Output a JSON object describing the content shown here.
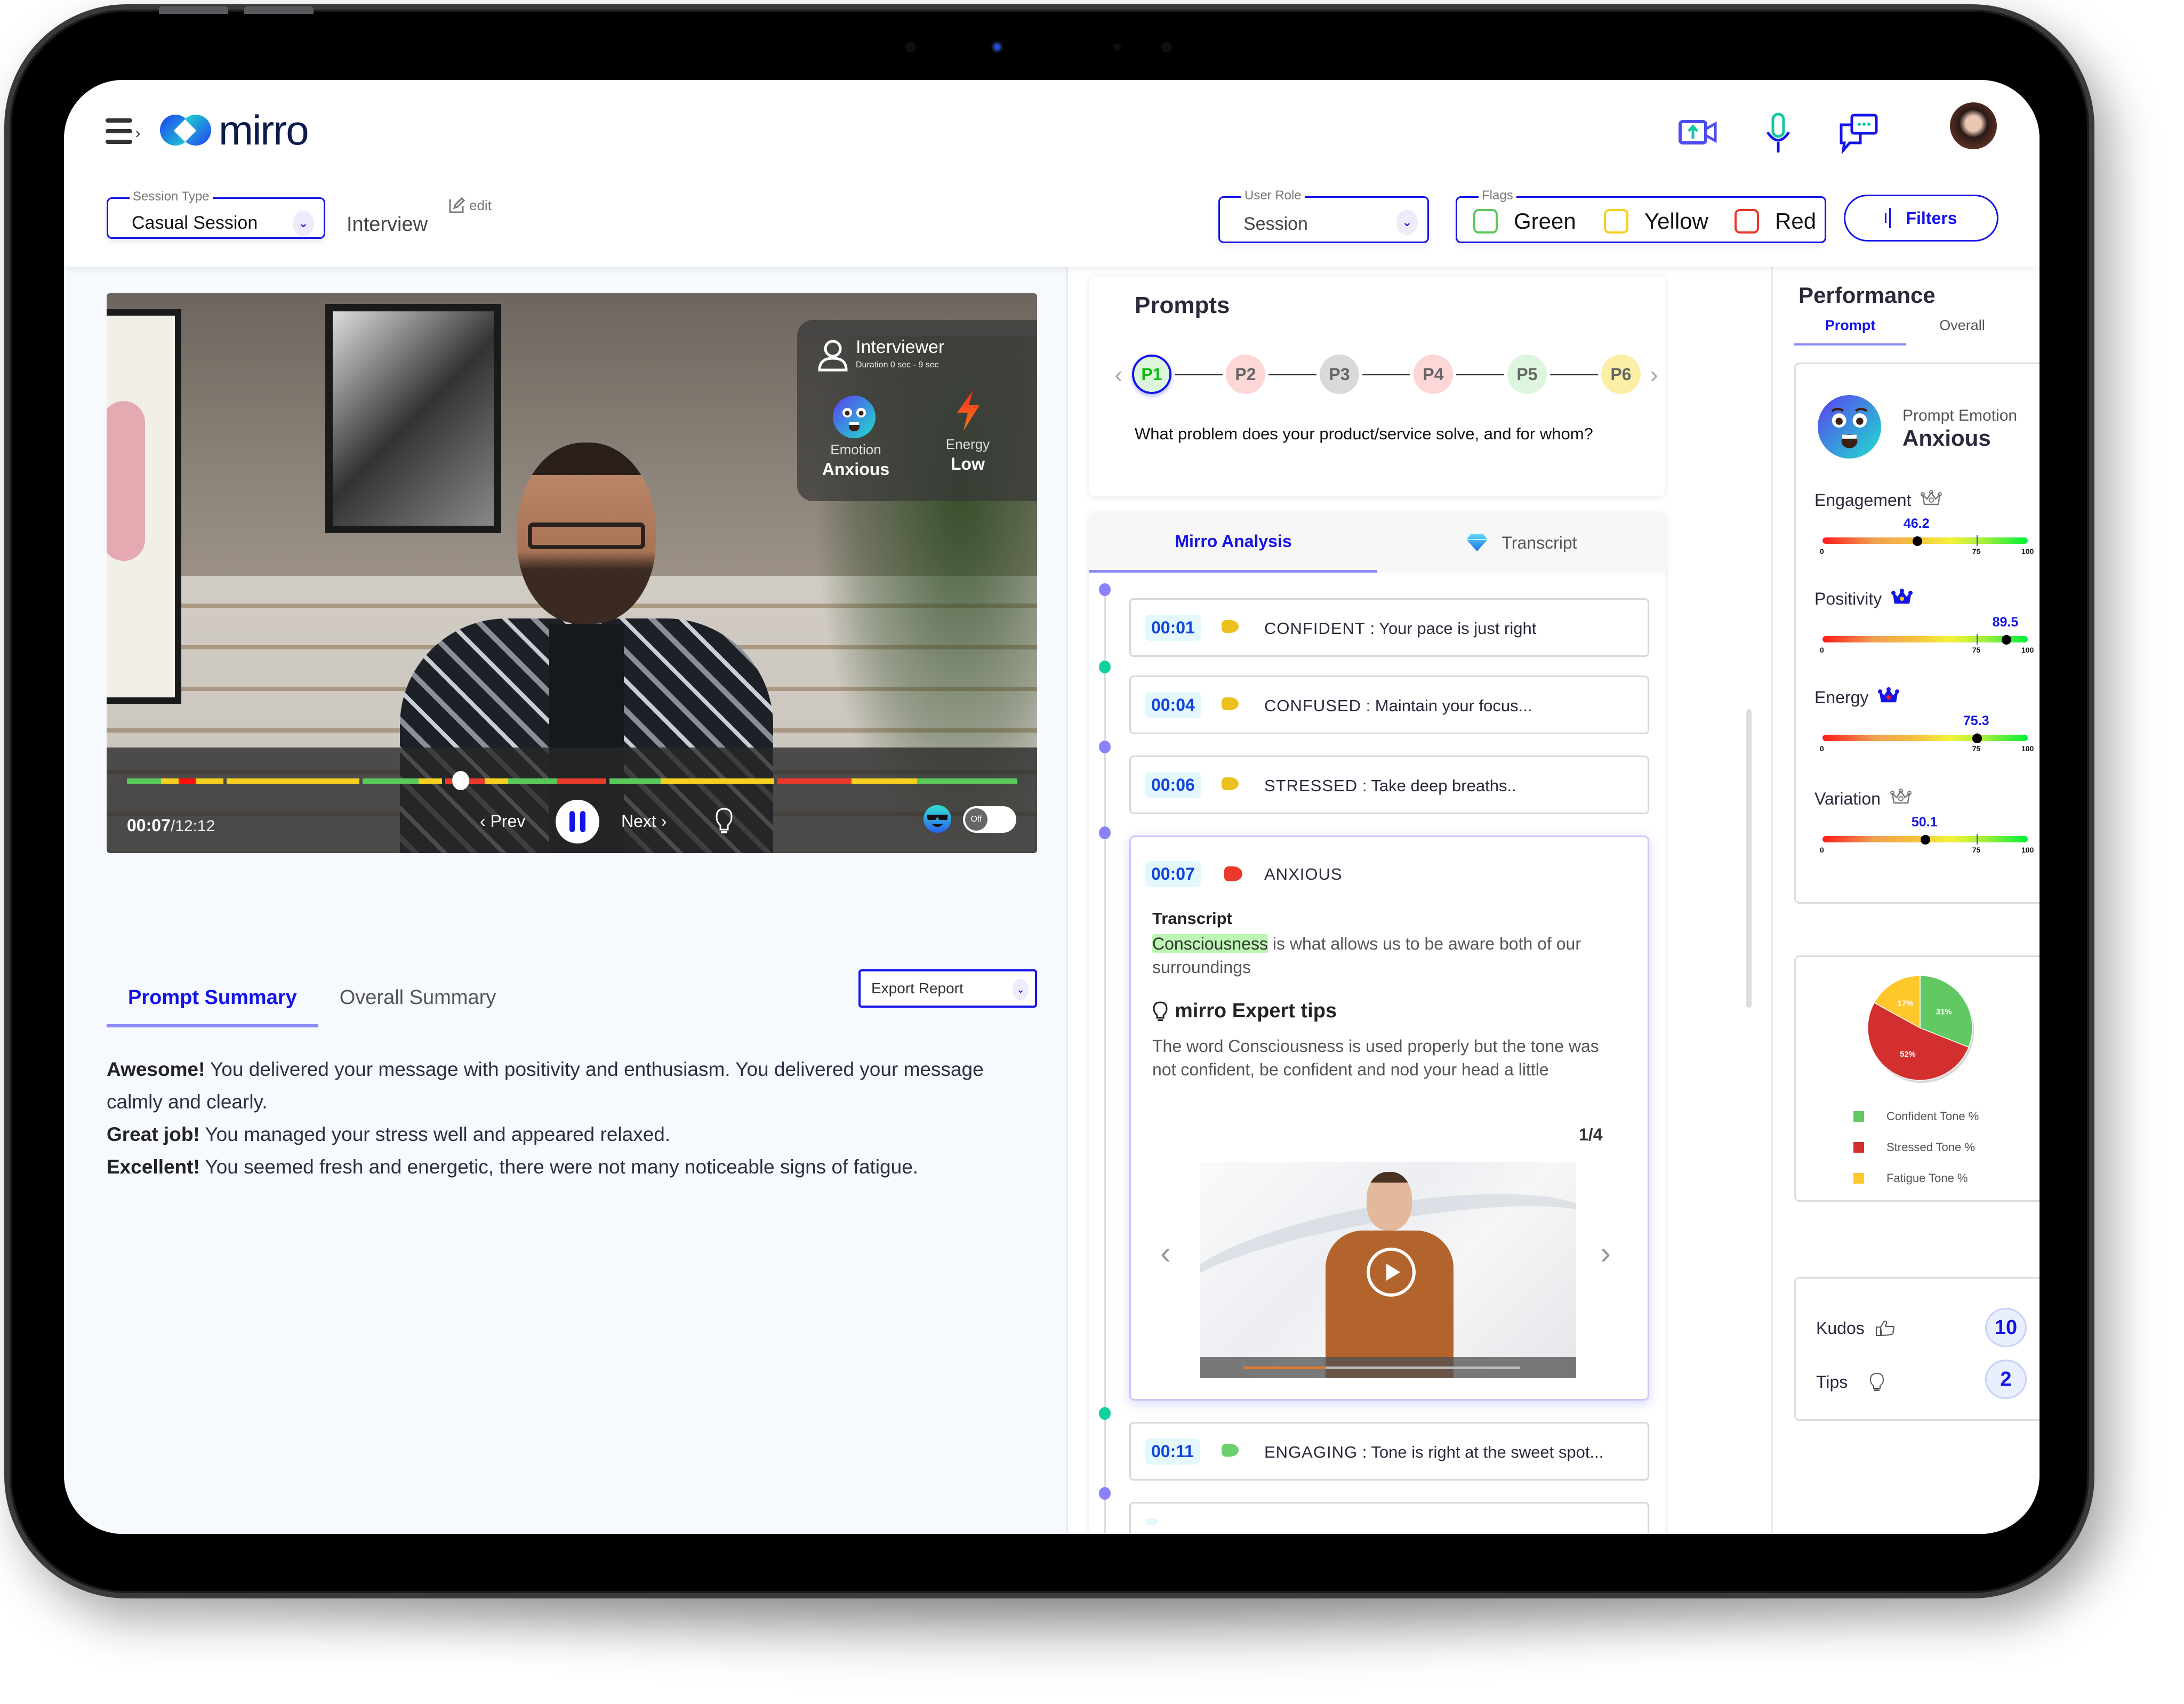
{
  "app": {
    "name": "mirro"
  },
  "header": {
    "icons": [
      "video-upload-icon",
      "microphone-icon",
      "chat-icon"
    ],
    "avatar_alt": "user-avatar"
  },
  "filters": {
    "session_type": {
      "legend": "Session Type",
      "value": "Casual Session"
    },
    "session_name": "Interview",
    "edit_label": "edit",
    "user_role": {
      "legend": "User Role",
      "value": "Session"
    },
    "flags": {
      "legend": "Flags",
      "options": [
        {
          "label": "Green",
          "color": "#5cc95c"
        },
        {
          "label": "Yellow",
          "color": "#f5d020"
        },
        {
          "label": "Red",
          "color": "#e8392a"
        }
      ]
    },
    "filters_button": "Filters"
  },
  "video": {
    "overlay": {
      "speaker": "Interviewer",
      "duration": "Duration 0 sec - 9 sec",
      "emotion_label": "Emotion",
      "emotion_value": "Anxious",
      "energy_label": "Energy",
      "energy_value": "Low"
    },
    "current_time": "00:07",
    "total_time": "12:12",
    "progress_fraction": 0.375,
    "prev_label": "Prev",
    "next_label": "Next",
    "toggle_label": "Off",
    "timeline_segments": [
      {
        "color": "#5ac85a",
        "w": 3.8
      },
      {
        "color": "#f5d020",
        "w": 2
      },
      {
        "color": "#ff1010",
        "w": 1.9
      },
      {
        "color": "#f5d020",
        "w": 3.1
      },
      {
        "gap": true
      },
      {
        "color": "#f5d020",
        "w": 14.8
      },
      {
        "gap": true
      },
      {
        "color": "#5ac85a",
        "w": 6.3
      },
      {
        "color": "#f5d020",
        "w": 2.6
      },
      {
        "gap": true
      },
      {
        "color": "#e8392a",
        "w": 4.4
      },
      {
        "color": "#f5d020",
        "w": 2.6
      },
      {
        "color": "#5ac85a",
        "w": 5.5
      },
      {
        "color": "#e8392a",
        "w": 5.5
      },
      {
        "gap": true
      },
      {
        "color": "#5ac85a",
        "w": 5.7
      },
      {
        "color": "#f5d020",
        "w": 12.7
      },
      {
        "gap": true
      },
      {
        "color": "#e8392a",
        "w": 8.3
      },
      {
        "color": "#f5d020",
        "w": 7.3
      },
      {
        "color": "#5ac85a",
        "w": 11.2
      }
    ]
  },
  "summary": {
    "tabs": [
      "Prompt Summary",
      "Overall Summary"
    ],
    "active_tab": 0,
    "export_label": "Export Report",
    "paragraphs": [
      {
        "lead": "Awesome!",
        "text": " You delivered your message with positivity and enthusiasm. You delivered your message calmly and clearly."
      },
      {
        "lead": "Great job!",
        "text": " You managed your stress well and appeared relaxed."
      },
      {
        "lead": "Excellent!",
        "text": " You seemed fresh and energetic, there were not many noticeable signs of fatigue."
      }
    ]
  },
  "prompts": {
    "title": "Prompts",
    "items": [
      {
        "label": "P1",
        "bg": "#dcf5dc",
        "active": true
      },
      {
        "label": "P2",
        "bg": "#fdd6d6"
      },
      {
        "label": "P3",
        "bg": "#d9d9d9"
      },
      {
        "label": "P4",
        "bg": "#fdd6d6"
      },
      {
        "label": "P5",
        "bg": "#dcf5dc"
      },
      {
        "label": "P6",
        "bg": "#fbefa6"
      }
    ],
    "question": "What problem does your product/service solve, and for whom?"
  },
  "analysis": {
    "tabs": [
      "Mirro Analysis",
      "Transcript"
    ],
    "active_tab": 0,
    "events": [
      {
        "time": "00:01",
        "flag": "#ecc01f",
        "emotion": "CONFIDENT",
        "note": "Your pace is just right",
        "dot": "#8a83f7"
      },
      {
        "time": "00:04",
        "flag": "#ecc01f",
        "emotion": "CONFUSED",
        "note": "Maintain your focus...",
        "dot": "#10d0a0"
      },
      {
        "time": "00:06",
        "flag": "#ecc01f",
        "emotion": "STRESSED",
        "note": "Take deep breaths..",
        "dot": "#8a83f7"
      }
    ],
    "expanded": {
      "time": "00:07",
      "flag": "#e8392a",
      "emotion": "ANXIOUS",
      "transcript_title": "Transcript",
      "highlight": "Consciousness",
      "transcript_rest": " is what allows us to be aware both of our surroundings",
      "tips_title": "mirro Expert tips",
      "tips": "The word Consciousness is used properly but the tone was not confident, be confident and nod your head a little",
      "pager": "1/4"
    },
    "after": [
      {
        "time": "00:11",
        "flag": "#6dd06d",
        "emotion": "ENGAGING",
        "note": "Tone is right at the sweet spot...",
        "dot": "#10d0a0"
      },
      {
        "time": "",
        "flag": "",
        "emotion": "",
        "note": "",
        "dot": "#8a83f7"
      }
    ]
  },
  "performance": {
    "title": "Performance",
    "tabs": [
      "Prompt",
      "Overall"
    ],
    "active_tab": 0,
    "emotion_label": "Prompt Emotion",
    "emotion_value": "Anxious",
    "metrics": [
      {
        "name": "Engagement",
        "value": 46.2,
        "value_label": "46.2",
        "crown": "outline"
      },
      {
        "name": "Positivity",
        "value": 89.5,
        "value_label": "89.5",
        "crown": "filled-yellow"
      },
      {
        "name": "Energy",
        "value": 75.3,
        "value_label": "75.3",
        "crown": "filled-red"
      },
      {
        "name": "Variation",
        "value": 50.1,
        "value_label": "50.1",
        "crown": "outline"
      }
    ],
    "gauge_labels": {
      "min": "0",
      "mid": "75",
      "max": "100"
    },
    "kudos": {
      "label": "Kudos",
      "count": "10"
    },
    "tips": {
      "label": "Tips",
      "count": "2"
    }
  },
  "chart_data": {
    "type": "pie",
    "title": "",
    "slices": [
      {
        "label": "Confident Tone %",
        "value": 31,
        "color": "#62c962",
        "display": "31%"
      },
      {
        "label": "Stressed Tone %",
        "value": 52,
        "color": "#d32f2f",
        "display": "52%"
      },
      {
        "label": "Fatigue Tone %",
        "value": 17,
        "color": "#fec72c",
        "display": "17%"
      }
    ],
    "legend_position": "bottom"
  }
}
